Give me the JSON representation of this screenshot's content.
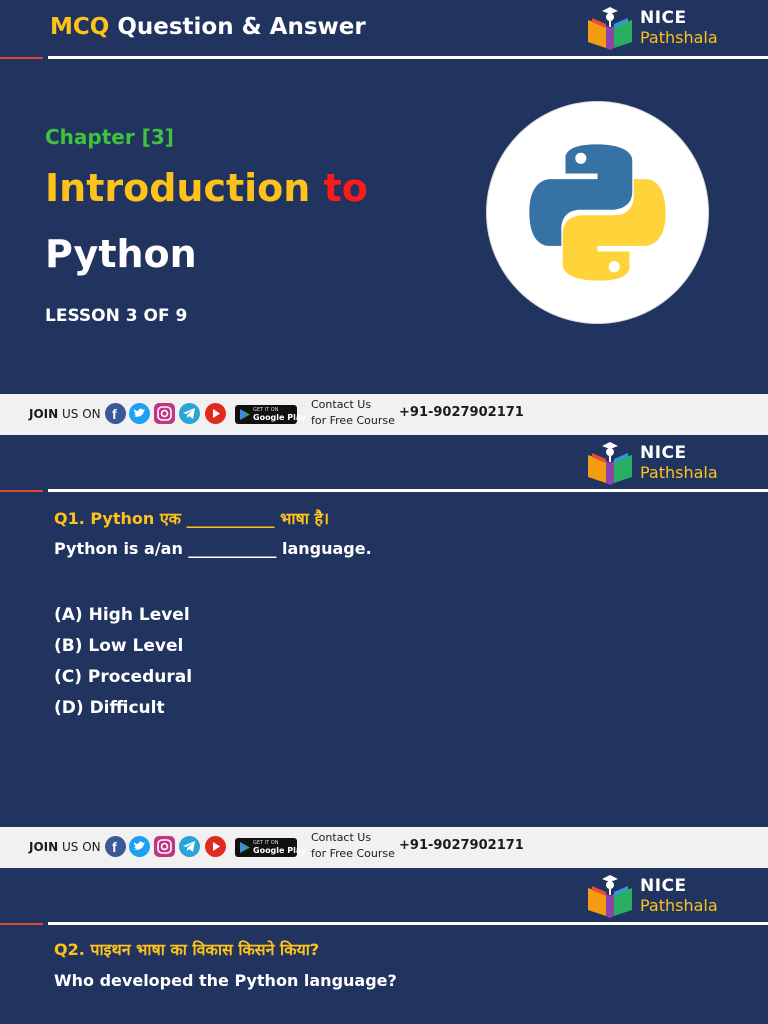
{
  "header": {
    "mcq_word": "MCQ",
    "title_rest": " Question & Answer"
  },
  "logo": {
    "line1": "NICE",
    "line2": "Pathshala"
  },
  "cover": {
    "chapter": "Chapter [3]",
    "title_word1": "Introduction",
    "title_word2": " to",
    "title_line2": "Python",
    "lesson": "LESSON 3 OF 9"
  },
  "footer": {
    "join_bold": "JOIN",
    "join_rest": " US ON",
    "play_small": "GET IT ON",
    "play_big": "Google Play",
    "contact_line1": "Contact Us",
    "contact_line2": "for Free Course",
    "phone": "+91-9027902171",
    "social_icons": [
      "facebook-icon",
      "twitter-icon",
      "instagram-icon",
      "telegram-icon",
      "youtube-icon"
    ]
  },
  "questions": [
    {
      "hindi": "Q1.  Python एक ___________ भाषा है।",
      "english": "Python is a/an ___________ language.",
      "options": [
        "(A) High Level",
        "(B) Low Level",
        "(C) Procedural",
        "(D) Difficult"
      ]
    },
    {
      "hindi": "Q2.  पाइथन भाषा का विकास किसने किया?",
      "english": "Who developed the Python language?"
    }
  ],
  "colors": {
    "background": "#213460",
    "accent_yellow": "#ffc21a",
    "accent_red": "#ff1a1a",
    "chapter_green": "#3fc33f",
    "python_blue": "#3772a4",
    "python_yellow": "#ffd43b"
  }
}
